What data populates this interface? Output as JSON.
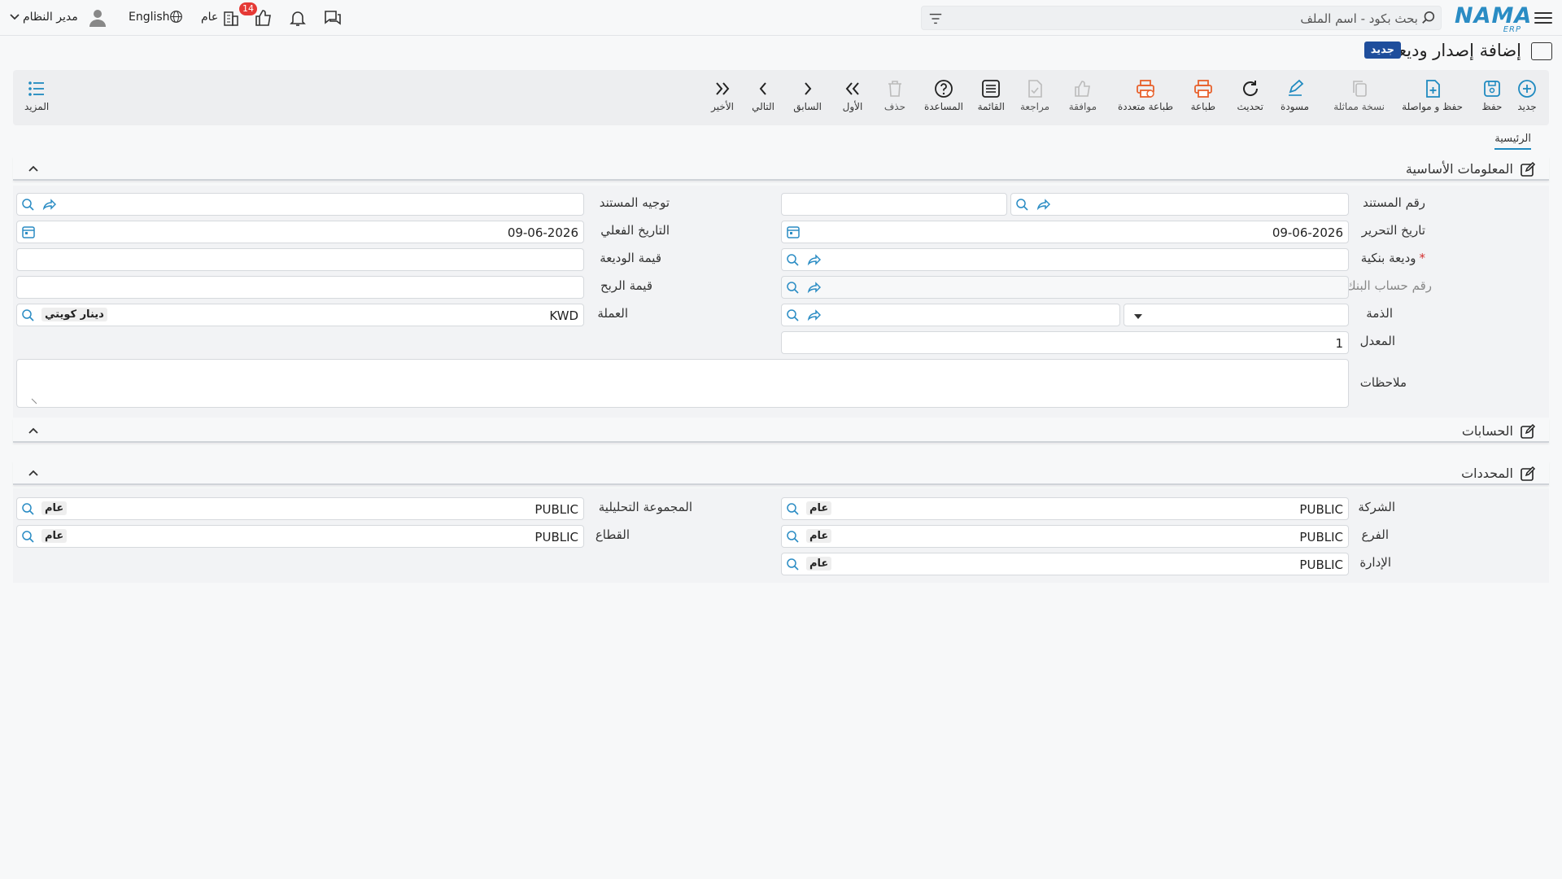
{
  "header": {
    "logo": "NAMA",
    "logo_sub": "ERP",
    "search_placeholder": "بحث بكود - اسم الملف",
    "badge_count": "14",
    "public_label": "عام",
    "language": "English",
    "user_name": "مدير النظام"
  },
  "page": {
    "title": "إضافة إصدار وديعة",
    "new_badge": "جديد"
  },
  "toolbar": {
    "new": "جديد",
    "save": "حفظ",
    "save_continue": "حفظ و مواصلة",
    "copy": "نسخة مماثلة",
    "draft": "مسودة",
    "refresh": "تحديث",
    "print": "طباعة",
    "multi_print": "طباعة متعددة",
    "approve": "موافقة",
    "review": "مراجعة",
    "list": "القائمة",
    "help": "المساعدة",
    "delete": "حذف",
    "first": "الأول",
    "previous": "السابق",
    "next": "التالي",
    "last": "الأخير",
    "more": "المزيد"
  },
  "tabs": {
    "main": "الرئيسية"
  },
  "basic_info": {
    "title": "المعلومات الأساسية",
    "doc_number_label": "رقم المستند",
    "doc_direction_label": "توجيه المستند",
    "edit_date_label": "تاريخ التحرير",
    "edit_date_value": "09-06-2026",
    "actual_date_label": "التاريخ الفعلي",
    "actual_date_value": "09-06-2026",
    "bank_deposit_label": "وديعة بنكية",
    "required_mark": "*",
    "deposit_value_label": "قيمة الوديعة",
    "bank_account_label": "رقم حساب البنك",
    "profit_value_label": "قيمة الربح",
    "debt_label": "الذمة",
    "currency_label": "العملة",
    "currency_code": "KWD",
    "currency_name": "دينار كويتي",
    "rate_label": "المعدل",
    "rate_value": "1",
    "notes_label": "ملاحظات"
  },
  "accounts": {
    "title": "الحسابات"
  },
  "dimensions": {
    "title": "المحددات",
    "company_label": "الشركة",
    "company_code": "PUBLIC",
    "company_name": "عام",
    "analytic_group_label": "المجموعة التحليلية",
    "analytic_group_code": "PUBLIC",
    "analytic_group_name": "عام",
    "branch_label": "الفرع",
    "branch_code": "PUBLIC",
    "branch_name": "عام",
    "sector_label": "القطاع",
    "sector_code": "PUBLIC",
    "sector_name": "عام",
    "department_label": "الإدارة",
    "department_code": "PUBLIC",
    "department_name": "عام"
  },
  "colors": {
    "accent": "#1f8ac0",
    "print": "#e8612c",
    "brand": "#2a8cc4",
    "badge": "#e53935"
  }
}
